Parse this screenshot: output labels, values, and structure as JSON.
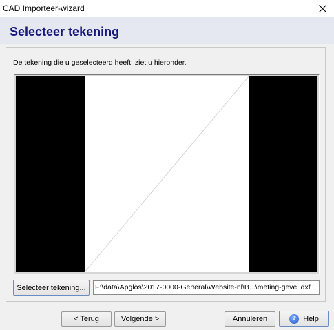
{
  "window": {
    "title": "CAD Importeer-wizard"
  },
  "header": {
    "title": "Selecteer tekening"
  },
  "main": {
    "description": "De tekening die u geselecteerd heeft, ziet u hieronder.",
    "select_button_label": "Selecteer tekening...",
    "file_path": "F:\\data\\Apglos\\2017-0000-General\\Website-nl\\B...\\meting-gevel.dxf"
  },
  "footer": {
    "back_label": "< Terug",
    "next_label": "Volgende >",
    "cancel_label": "Annuleren",
    "help_label": "Help"
  },
  "icons": {
    "close": "close-icon",
    "help": "help-icon"
  },
  "colors": {
    "heading": "#17177a",
    "header_bg": "#e6e8f1",
    "preview_bg": "#000000",
    "drawing_bg": "#ffffff"
  }
}
